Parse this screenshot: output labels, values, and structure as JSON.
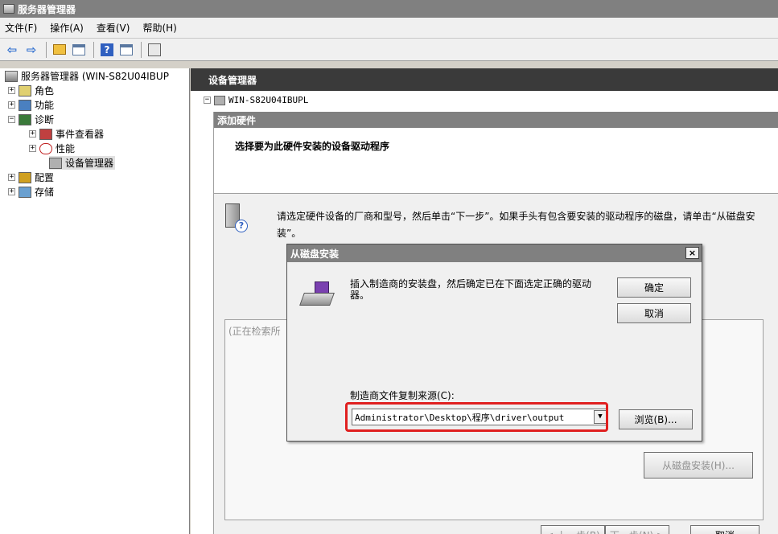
{
  "window": {
    "title": "服务器管理器"
  },
  "menu": [
    "文件(F)",
    "操作(A)",
    "查看(V)",
    "帮助(H)"
  ],
  "toolbar": {
    "icons": [
      "back-arrow-icon",
      "forward-arrow-icon",
      "up-folder-icon",
      "show-hide-tree-icon",
      "help-icon",
      "show-hide-action-pane-icon",
      "device-properties-icon"
    ]
  },
  "tree": {
    "root": "服务器管理器 (WIN-S82U04IBUP",
    "roles": "角色",
    "features": "功能",
    "diagnostics": "诊断",
    "event_viewer": "事件查看器",
    "performance": "性能",
    "device_manager": "设备管理器",
    "configuration": "配置",
    "storage": "存储"
  },
  "right": {
    "header": "设备管理器",
    "device_root": "WIN-S82U04IBUPL"
  },
  "wizard": {
    "title": "添加硬件",
    "heading": "选择要为此硬件安装的设备驱动程序",
    "description": "请选定硬件设备的厂商和型号，然后单击“下一步”。如果手头有包含要安装的驱动程序的磁盘，请单击“从磁盘安装”。",
    "searching": "(正在检索所",
    "have_disk_button": "从磁盘安装(H)...",
    "back_button": "< 上一步(B)",
    "next_button": "下一步(N) >",
    "cancel_button": "取消"
  },
  "dialog": {
    "title": "从磁盘安装",
    "close": "×",
    "message": "插入制造商的安装盘，然后确定已在下面选定正确的驱动器。",
    "ok_button": "确定",
    "cancel_button": "取消",
    "source_label": "制造商文件复制来源(C):",
    "source_value": "Administrator\\Desktop\\程序\\driver\\output",
    "browse_button": "浏览(B)...",
    "dropdown_arrow": "▼"
  },
  "colors": {
    "highlight": "#e02020",
    "title_bar": "#808080",
    "header": "#3a3a3a"
  }
}
